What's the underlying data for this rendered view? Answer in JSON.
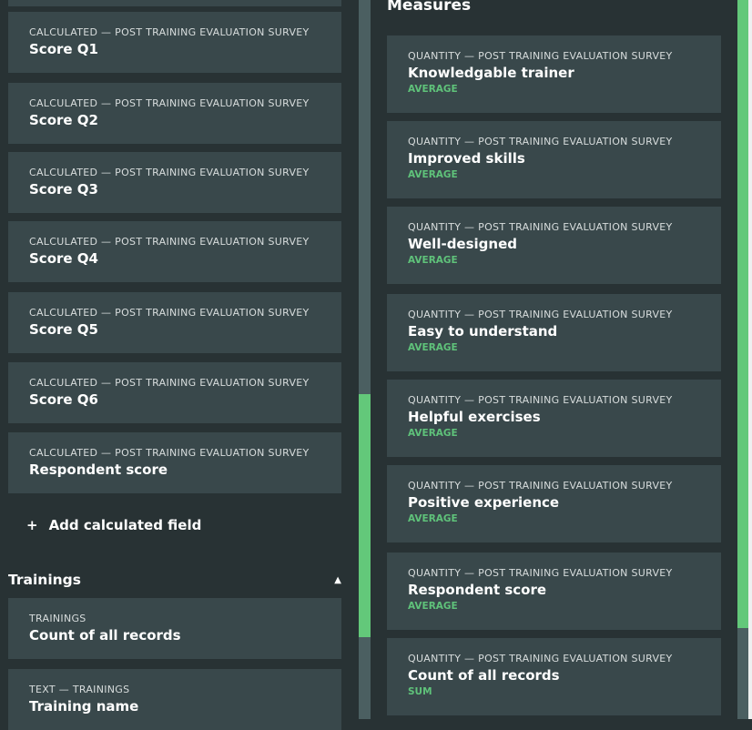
{
  "left_panel": {
    "calculated_cards": [
      {
        "meta": "CALCULATED — POST TRAINING EVALUATION SURVEY",
        "name": "Score Q1"
      },
      {
        "meta": "CALCULATED — POST TRAINING EVALUATION SURVEY",
        "name": "Score Q2"
      },
      {
        "meta": "CALCULATED — POST TRAINING EVALUATION SURVEY",
        "name": "Score Q3"
      },
      {
        "meta": "CALCULATED — POST TRAINING EVALUATION SURVEY",
        "name": "Score Q4"
      },
      {
        "meta": "CALCULATED — POST TRAINING EVALUATION SURVEY",
        "name": "Score Q5"
      },
      {
        "meta": "CALCULATED — POST TRAINING EVALUATION SURVEY",
        "name": "Score Q6"
      },
      {
        "meta": "CALCULATED — POST TRAINING EVALUATION SURVEY",
        "name": "Respondent score"
      }
    ],
    "add_calculated_field": {
      "icon": "+",
      "label": "Add calculated field"
    },
    "trainings_section": {
      "title": "Trainings",
      "toggle_icon": "▲",
      "cards": [
        {
          "meta": "TRAININGS",
          "name": "Count of all records"
        },
        {
          "meta": "TEXT — TRAININGS",
          "name": "Training name"
        }
      ]
    }
  },
  "right_panel": {
    "title": "Measures",
    "cards": [
      {
        "meta": "QUANTITY — POST TRAINING EVALUATION SURVEY",
        "name": "Knowledgable trainer",
        "agg": "AVERAGE"
      },
      {
        "meta": "QUANTITY — POST TRAINING EVALUATION SURVEY",
        "name": "Improved skills",
        "agg": "AVERAGE"
      },
      {
        "meta": "QUANTITY — POST TRAINING EVALUATION SURVEY",
        "name": "Well-designed",
        "agg": "AVERAGE"
      },
      {
        "meta": "QUANTITY — POST TRAINING EVALUATION SURVEY",
        "name": "Easy to understand",
        "agg": "AVERAGE"
      },
      {
        "meta": "QUANTITY — POST TRAINING EVALUATION SURVEY",
        "name": "Helpful exercises",
        "agg": "AVERAGE"
      },
      {
        "meta": "QUANTITY — POST TRAINING EVALUATION SURVEY",
        "name": "Positive experience",
        "agg": "AVERAGE"
      },
      {
        "meta": "QUANTITY — POST TRAINING EVALUATION SURVEY",
        "name": "Respondent score",
        "agg": "AVERAGE"
      },
      {
        "meta": "QUANTITY — POST TRAINING EVALUATION SURVEY",
        "name": "Count of all records",
        "agg": "SUM"
      }
    ]
  },
  "colors": {
    "accent": "#63c87a",
    "panel": "#283234",
    "card": "#39484b"
  }
}
